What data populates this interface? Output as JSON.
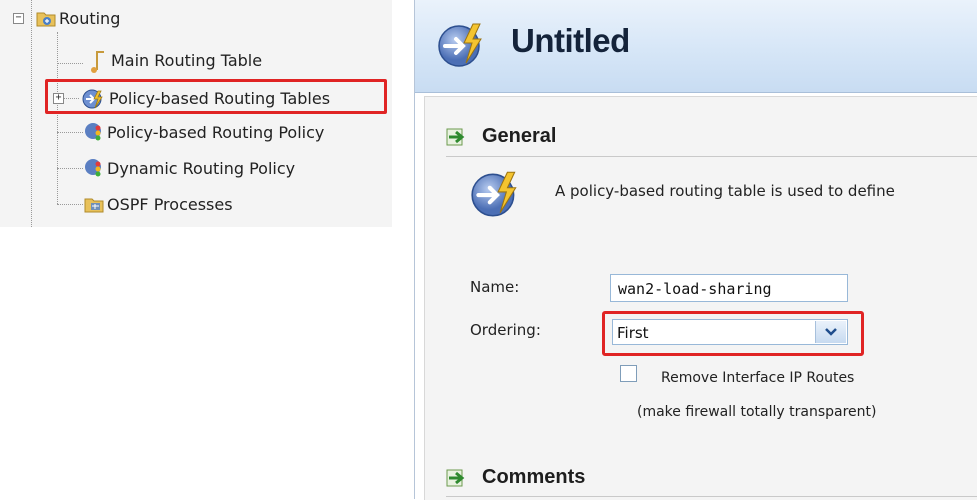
{
  "tree": {
    "root": {
      "label": "Routing",
      "icon": "routing-folder-icon",
      "expander": "−"
    },
    "items": [
      {
        "label": "Main Routing Table",
        "icon": "routing-table-icon"
      },
      {
        "label": "Policy-based Routing Tables",
        "icon": "policy-routing-table-icon",
        "expander": "+",
        "selected": true
      },
      {
        "label": "Policy-based Routing Policy",
        "icon": "traffic-light-icon"
      },
      {
        "label": "Dynamic Routing Policy",
        "icon": "traffic-light-icon"
      },
      {
        "label": "OSPF Processes",
        "icon": "ospf-folder-icon"
      }
    ]
  },
  "dialog": {
    "title": "Untitled",
    "sections": {
      "general": "General",
      "comments": "Comments"
    },
    "description": "A policy-based routing table is used to define",
    "form": {
      "name_label": "Name:",
      "name_value": "wan2-load-sharing",
      "ordering_label": "Ordering:",
      "ordering_value": "First",
      "remove_routes_label": "Remove Interface IP Routes",
      "remove_routes_checked": false,
      "remove_routes_hint": "(make firewall totally transparent)"
    }
  },
  "colors": {
    "highlight": "#e02424",
    "banner": "#d6e6f7",
    "panel_bg": "#f4f4f4"
  }
}
